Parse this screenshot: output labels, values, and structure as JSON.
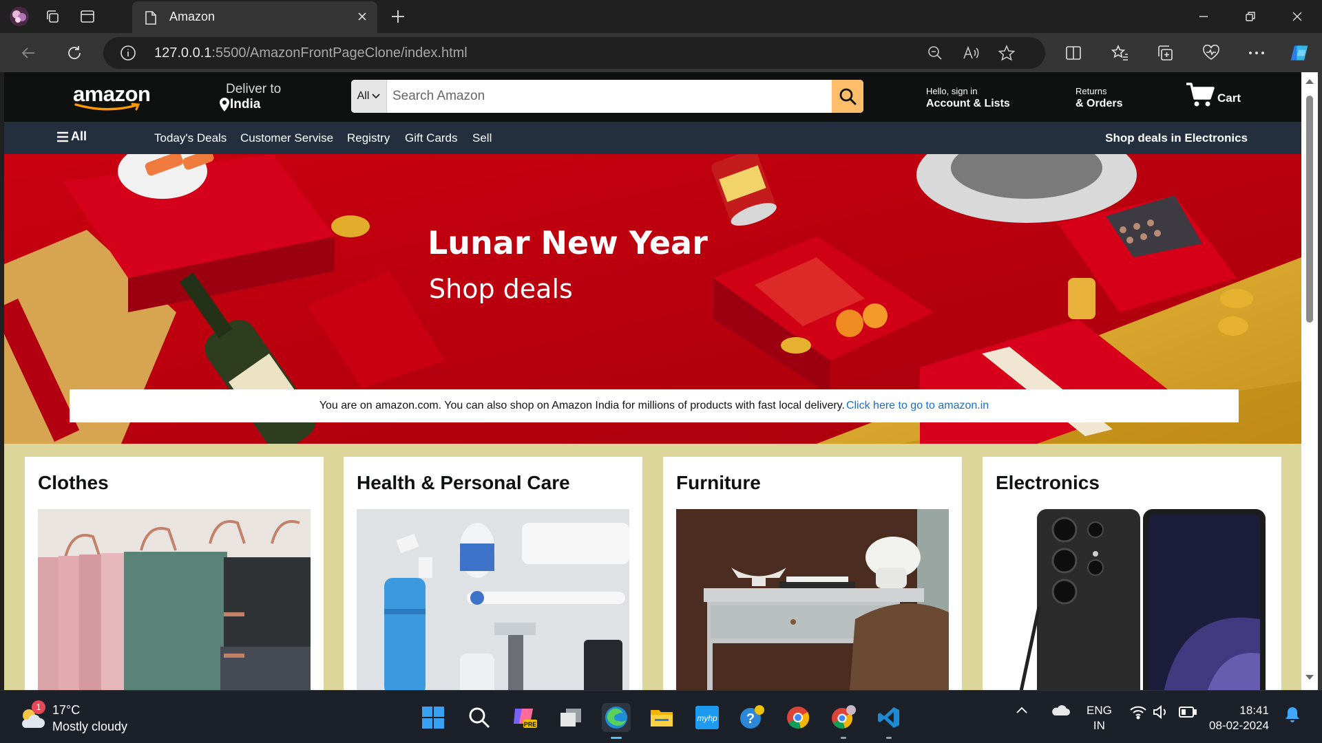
{
  "browser": {
    "tab_title": "Amazon",
    "url_host": "127.0.0.1",
    "url_rest": ":5500/AmazonFrontPageClone/index.html"
  },
  "header": {
    "logo": "amazon",
    "deliver_line1": "Deliver to",
    "deliver_line2": "India",
    "search_category": "All",
    "search_placeholder": "Search Amazon",
    "account_small": "Hello, sign in",
    "account_big": "Account & Lists",
    "returns_small": "Returns",
    "returns_big": "& Orders",
    "cart_label": "Cart"
  },
  "subnav": {
    "all_label": "All",
    "items": [
      "Today's Deals",
      "Customer Servise",
      "Registry",
      "Gift Cards",
      "Sell"
    ],
    "deals": "Shop deals in Electronics"
  },
  "hero": {
    "title": "Lunar New Year",
    "subtitle": "Shop deals",
    "notice_text": "You are on amazon.com. You can also shop on Amazon India for millions of products with fast local delivery.",
    "notice_link": "Click here to go to amazon.in"
  },
  "cards": [
    {
      "title": "Clothes"
    },
    {
      "title": "Health & Personal Care"
    },
    {
      "title": "Furniture"
    },
    {
      "title": "Electronics"
    }
  ],
  "taskbar": {
    "weather_temp": "17°C",
    "weather_desc": "Mostly cloudy",
    "weather_badge": "1",
    "lang_line1": "ENG",
    "lang_line2": "IN",
    "time": "18:41",
    "date": "08-02-2024"
  },
  "colors": {
    "amazon_dark": "#0f1111",
    "subnav": "#232f3e",
    "search_button": "#febd69",
    "hero_red": "#c0000f",
    "cards_bg": "#dcd69a",
    "link_blue": "#1a6fc2"
  }
}
